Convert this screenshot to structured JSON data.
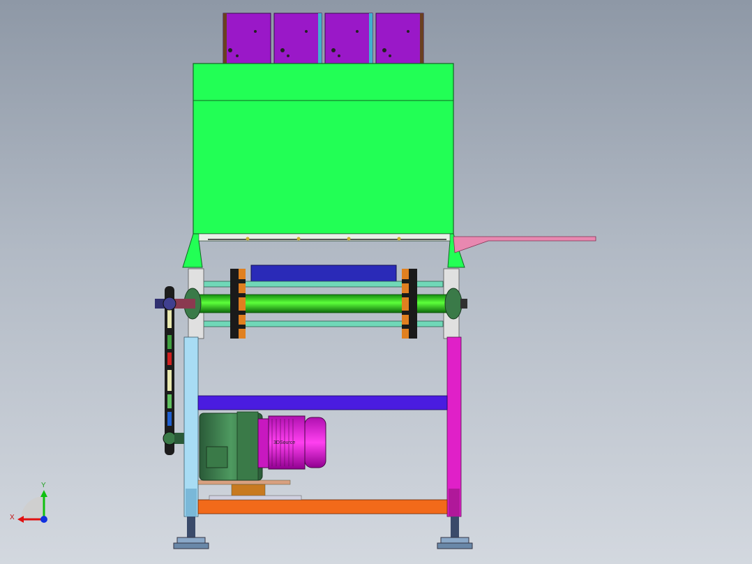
{
  "viewport": {
    "background_top": "#8e98a6",
    "background_bottom": "#d3d8df"
  },
  "model": {
    "motor_label": "3DSource"
  },
  "triad": {
    "x_label": "X",
    "y_label": "Y",
    "x_color": "#e01010",
    "y_color": "#10c010",
    "z_color": "#1030e0"
  },
  "colors": {
    "hopper": "#22ff55",
    "feeder": "#9a18c8",
    "roller": "#2fd81a",
    "motor": "#d81ad8",
    "gearbox": "#3a7a4a",
    "leg_left": "#a8dcf4",
    "leg_right": "#e020c8",
    "crossbar_top": "#4a1ce0",
    "crossbar_bottom": "#f26a1a",
    "chute": "#e888b0"
  }
}
